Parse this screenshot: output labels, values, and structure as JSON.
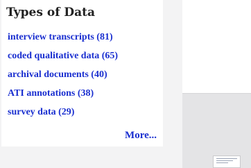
{
  "types_panel": {
    "title": "Types of Data",
    "items": [
      {
        "label": "interview transcripts (81)"
      },
      {
        "label": "coded qualitative data (65)"
      },
      {
        "label": "archival documents (40)"
      },
      {
        "label": "ATI annotations (38)"
      },
      {
        "label": "survey data (29)"
      }
    ],
    "more_label": "More..."
  },
  "colors": {
    "link": "#1a2fd0",
    "title": "#222222",
    "page_background": "#f3f3f4",
    "card_background": "#ffffff",
    "right_panel_lower": "#e4e4e6"
  },
  "icons": {
    "thumbnail": "document-thumbnail-icon"
  }
}
